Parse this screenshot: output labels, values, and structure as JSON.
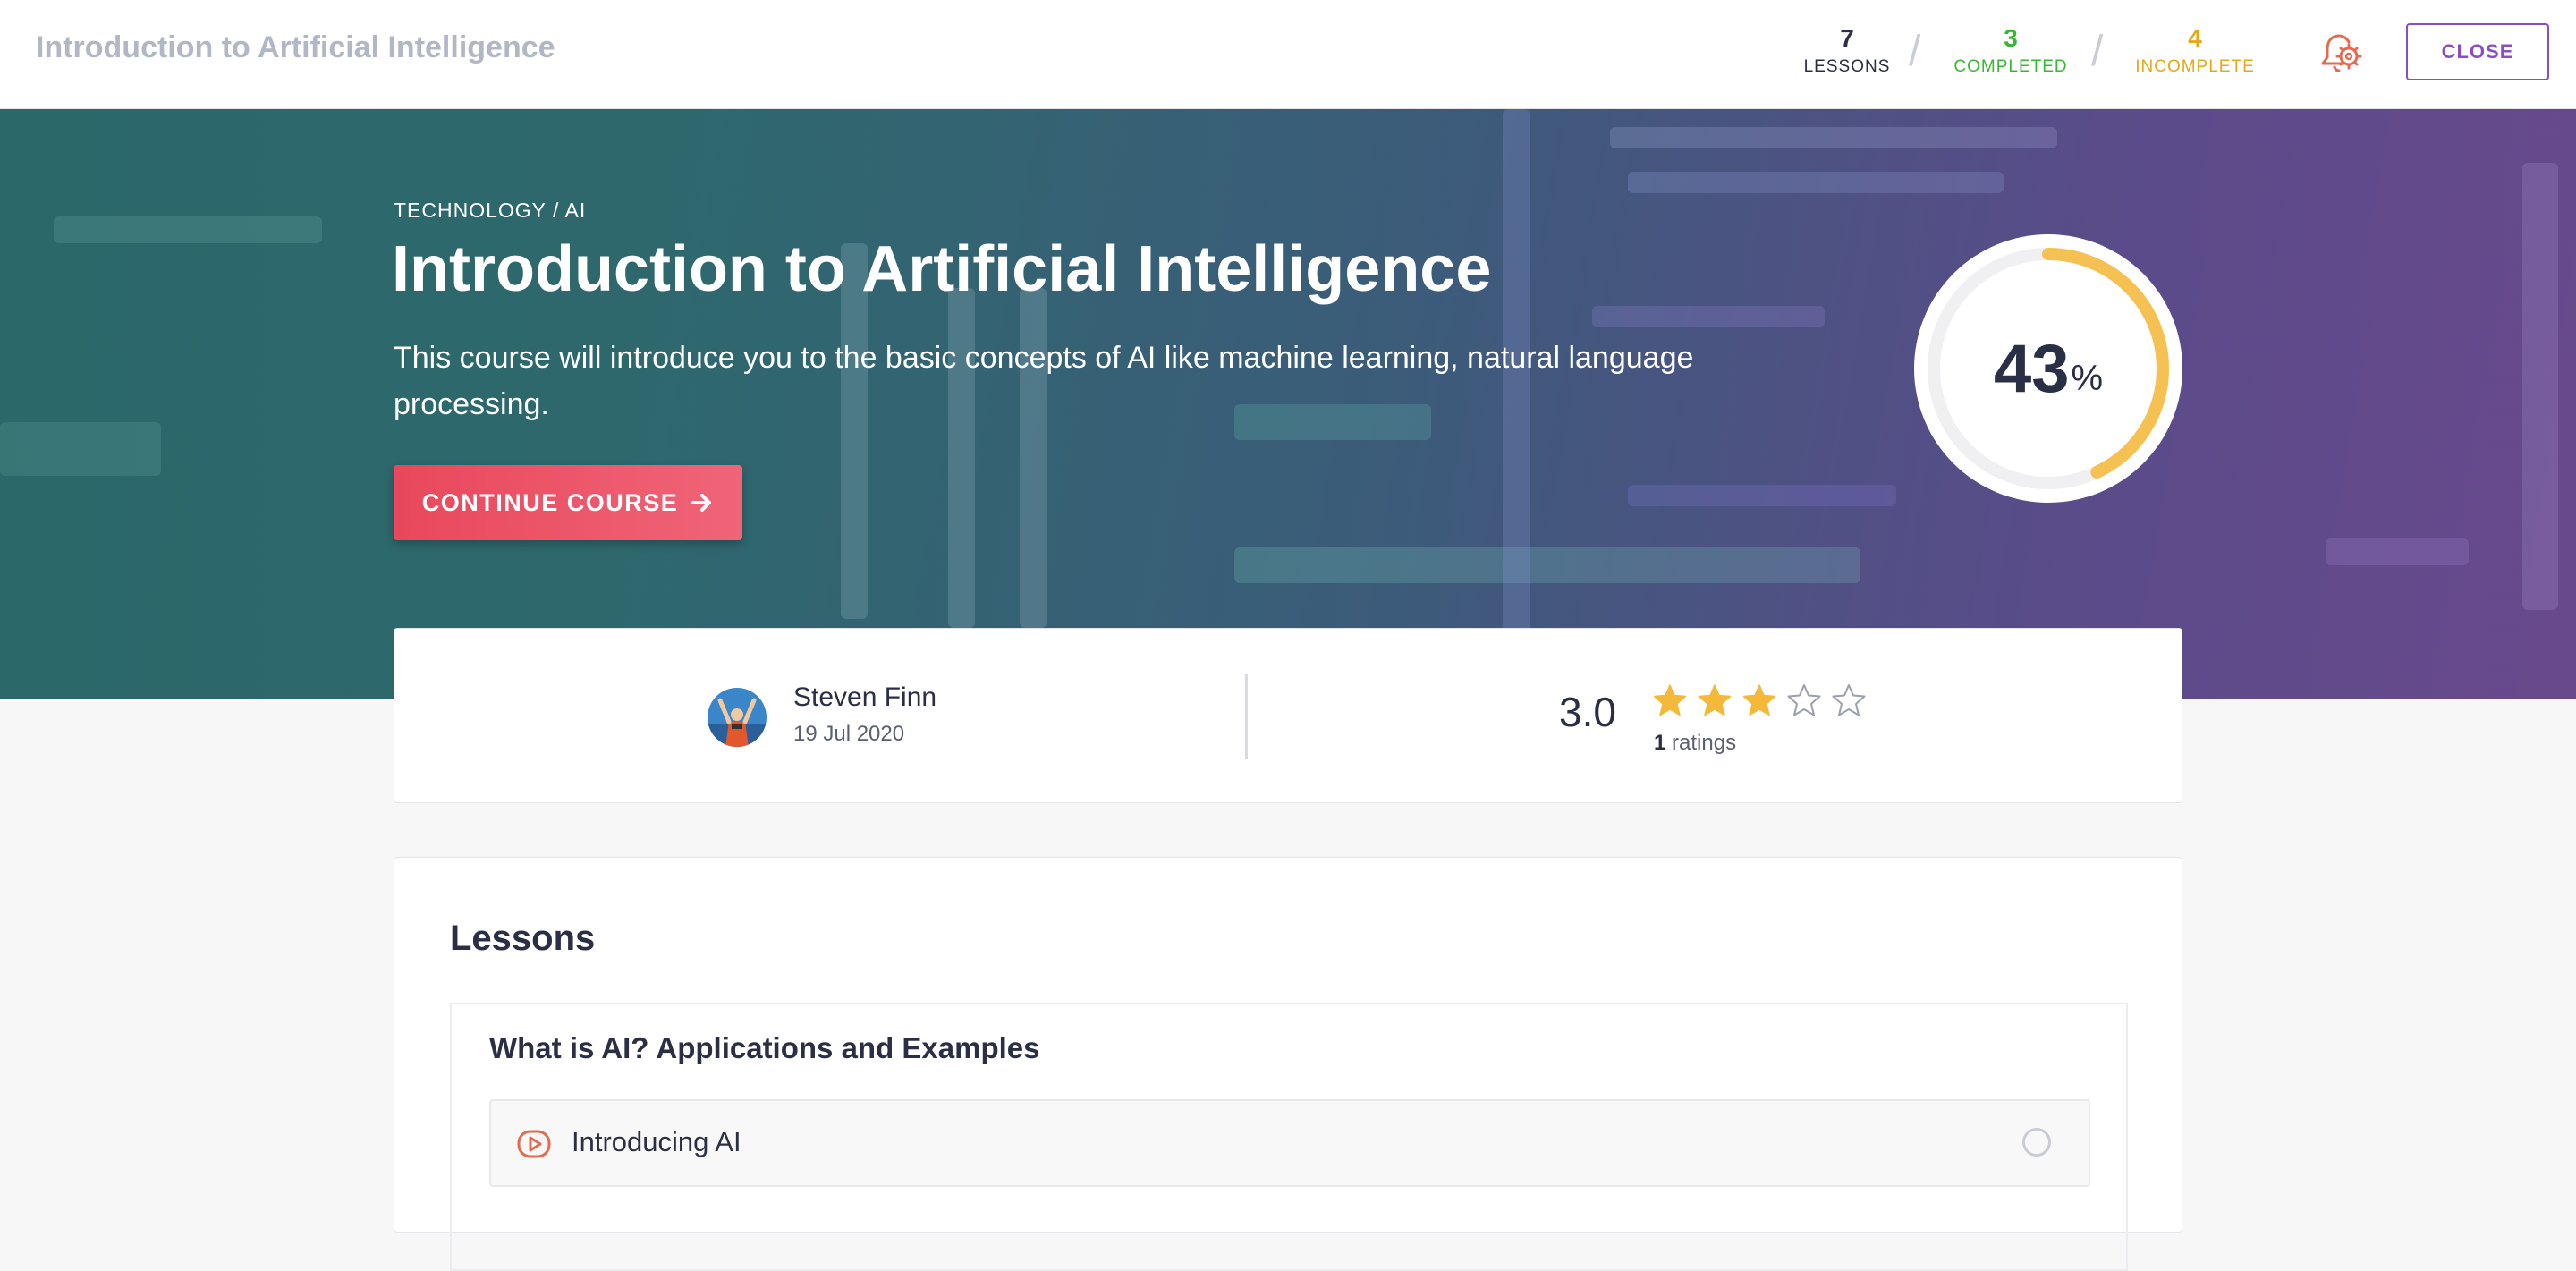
{
  "header": {
    "app_title": "Introduction to Artificial Intelligence",
    "stats": {
      "lessons": {
        "value": "7",
        "label": "LESSONS"
      },
      "completed": {
        "value": "3",
        "label": "COMPLETED"
      },
      "incomplete": {
        "value": "4",
        "label": "INCOMPLETE"
      }
    },
    "settings_icon": "gear-bell-icon",
    "close_label": "CLOSE"
  },
  "hero": {
    "breadcrumb": "TECHNOLOGY / AI",
    "title": "Introduction to Artificial Intelligence",
    "description": "This course will introduce you to the basic concepts of AI like machine learning, natural language processing.",
    "continue_label": "CONTINUE COURSE",
    "continue_icon": "arrow-right-icon",
    "progress": {
      "value": "43",
      "unit": "%",
      "fraction": 0.43,
      "color": "#f5c152"
    }
  },
  "info": {
    "author_name": "Steven Finn",
    "author_date": "19 Jul 2020",
    "rating_value": "3.0",
    "rating_stars": 3,
    "rating_max": 5,
    "rating_count": "1",
    "rating_count_label": "ratings",
    "star_color": "#f5b93a"
  },
  "lessons": {
    "heading": "Lessons",
    "sections": [
      {
        "title": "What is AI? Applications and Examples",
        "items": [
          {
            "title": "Introducing AI",
            "icon": "video-play-icon"
          }
        ]
      }
    ]
  },
  "colors": {
    "accent_purple": "#8b4cc4",
    "completed_green": "#36b832",
    "incomplete_orange": "#e5a818",
    "cta_red": "#e9485c"
  }
}
